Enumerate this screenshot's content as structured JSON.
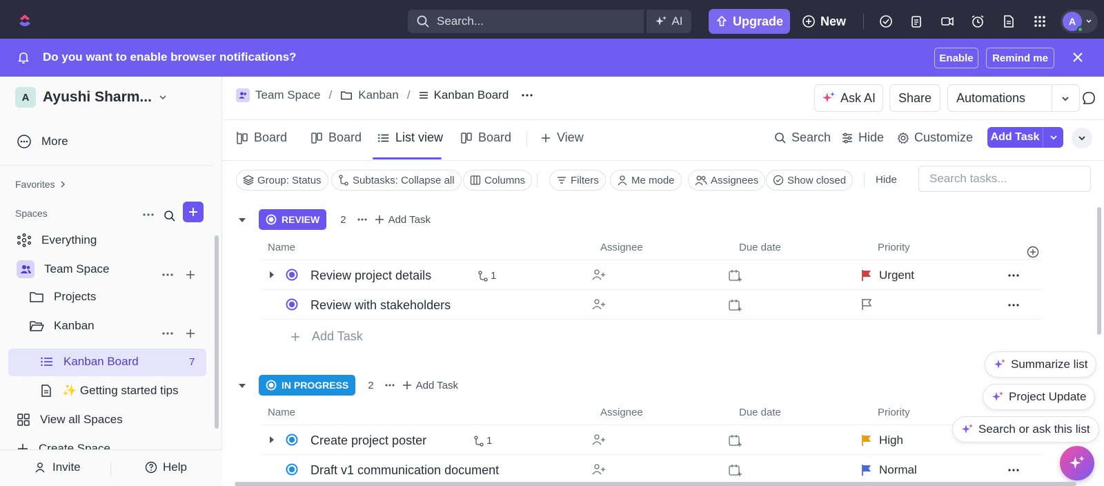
{
  "topbar": {
    "search_placeholder": "Search...",
    "ai_label": "AI",
    "upgrade_label": "Upgrade",
    "new_label": "New",
    "avatar_initial": "A"
  },
  "notification": {
    "message": "Do you want to enable browser notifications?",
    "enable_label": "Enable",
    "remind_label": "Remind me"
  },
  "sidebar": {
    "workspace_initial": "A",
    "workspace_name": "Ayushi Sharm...",
    "more_label": "More",
    "favorites_label": "Favorites",
    "spaces_label": "Spaces",
    "items": {
      "everything": "Everything",
      "team_space": "Team Space",
      "projects": "Projects",
      "kanban": "Kanban",
      "kanban_board": "Kanban Board",
      "kanban_board_count": "7",
      "getting_started": "✨ Getting started tips",
      "view_all_spaces": "View all Spaces",
      "create_space": "Create Space"
    },
    "footer": {
      "invite": "Invite",
      "help": "Help"
    }
  },
  "breadcrumb": {
    "team_space": "Team Space",
    "kanban": "Kanban",
    "kanban_board": "Kanban Board"
  },
  "header_buttons": {
    "ask_ai": "Ask AI",
    "share": "Share",
    "automations": "Automations"
  },
  "tabs": {
    "board1": "Board",
    "board2": "Board",
    "list_view": "List view",
    "board3": "Board",
    "view": "View"
  },
  "toolbar": {
    "search": "Search",
    "hide": "Hide",
    "customize": "Customize",
    "add_task": "Add Task"
  },
  "filters": {
    "group": "Group: Status",
    "subtasks": "Subtasks: Collapse all",
    "columns": "Columns",
    "filters": "Filters",
    "me_mode": "Me mode",
    "assignees": "Assignees",
    "show_closed": "Show closed",
    "hide": "Hide",
    "search_placeholder": "Search tasks..."
  },
  "columns": {
    "name": "Name",
    "assignee": "Assignee",
    "due_date": "Due date",
    "priority": "Priority"
  },
  "groups": {
    "review": {
      "label": "REVIEW",
      "count": "2",
      "add_task": "Add Task",
      "color": "#6b55f0",
      "tasks": [
        {
          "name": "Review project details",
          "subtasks": "1",
          "priority": "Urgent",
          "flag_color": "#d33d44"
        },
        {
          "name": "Review with stakeholders",
          "subtasks": "",
          "priority": "",
          "flag_color": "#8a8e99"
        }
      ],
      "add_row": "Add Task"
    },
    "in_progress": {
      "label": "IN PROGRESS",
      "count": "2",
      "add_task": "Add Task",
      "color": "#1a90e0",
      "tasks": [
        {
          "name": "Create project poster",
          "subtasks": "1",
          "priority": "High",
          "flag_color": "#e8a10e"
        },
        {
          "name": "Draft v1 communication document",
          "subtasks": "",
          "priority": "Normal",
          "flag_color": "#4b6bdb"
        }
      ]
    }
  },
  "ai_actions": {
    "summarize": "Summarize list",
    "project_update": "Project Update",
    "search_ask": "Search or ask this list"
  }
}
